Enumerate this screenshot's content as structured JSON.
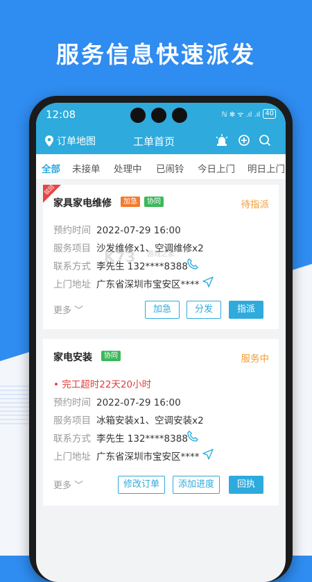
{
  "headline": "服务信息快速派发",
  "status_bar": {
    "time": "12:08",
    "icons": "ℕ ✻ ᯤ .ıl .ıl",
    "battery": "40"
  },
  "nav": {
    "left_label": "订单地图",
    "title": "工单首页"
  },
  "tabs": [
    "全部",
    "未接单",
    "处理中",
    "已闹铃",
    "今日上门",
    "明日上门"
  ],
  "cards": [
    {
      "ribbon": "驳回",
      "title": "家具家电维修",
      "badges": [
        "加急",
        "协同"
      ],
      "status": "待指派",
      "rows": [
        {
          "label": "预约时间",
          "value": "2022-07-29 16:00"
        },
        {
          "label": "服务项目",
          "value": "沙发维修x1、空调维修x2"
        },
        {
          "label": "联系方式",
          "value": "李先生 132****8388"
        },
        {
          "label": "上门地址",
          "value": "广东省深圳市宝安区****"
        }
      ],
      "more": "更多",
      "buttons": [
        "加急",
        "分发",
        "指派"
      ]
    },
    {
      "title": "家电安装",
      "badges": [
        "协同"
      ],
      "status": "服务中",
      "alert": "• 完工超时22天20小时",
      "rows": [
        {
          "label": "预约时间",
          "value": "2022-07-29 16:00"
        },
        {
          "label": "服务项目",
          "value": "冰箱安装x1、空调安装x2"
        },
        {
          "label": "联系方式",
          "value": "李先生 132****8388"
        },
        {
          "label": "上门地址",
          "value": "广东省深圳市宝安区****"
        }
      ],
      "more": "更多",
      "buttons": [
        "修改订单",
        "添加进度",
        "回执"
      ]
    }
  ],
  "watermark": {
    "logo": "K73",
    "sub": "游戏之家"
  },
  "colors": {
    "primary": "#2eaadc",
    "background": "#2f8cf0",
    "status_orange": "#f39c33",
    "alert_red": "#e23b3b"
  }
}
